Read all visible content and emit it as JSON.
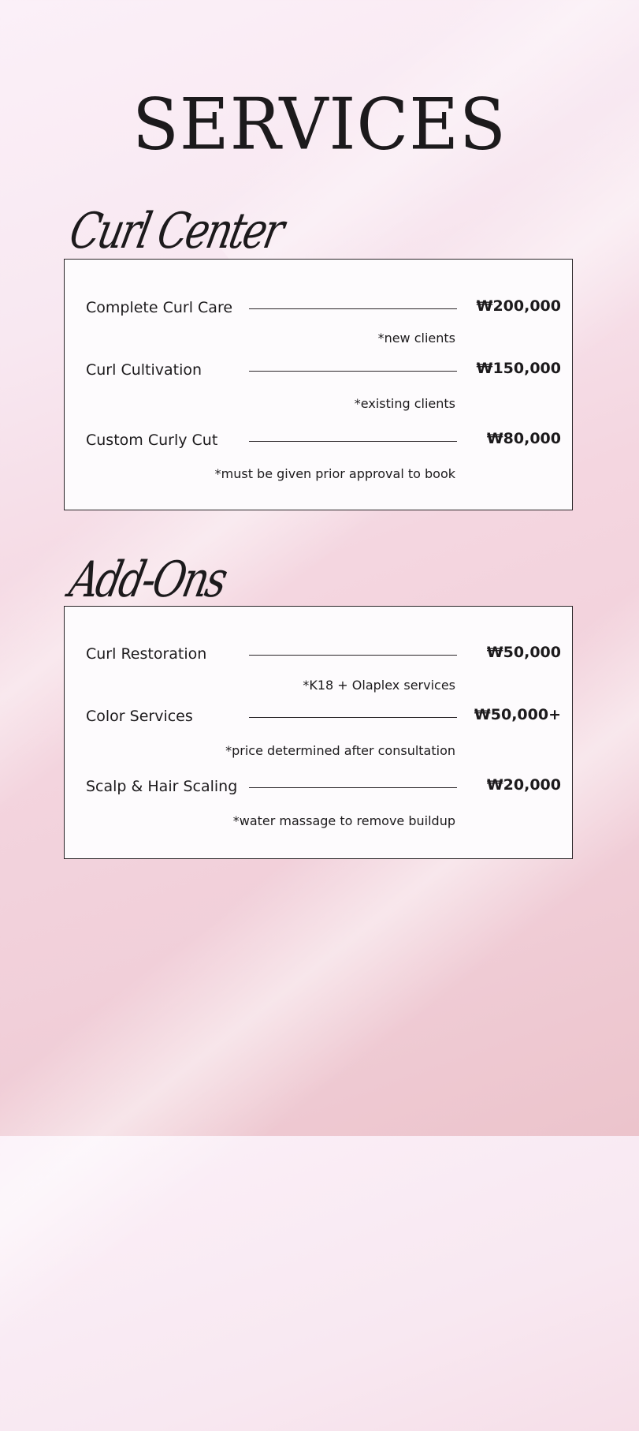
{
  "page": {
    "title": "SERVICES"
  },
  "sections": [
    {
      "heading": "Curl Center",
      "services": [
        {
          "name": "Complete Curl Care",
          "price": "₩200,000",
          "note": "*new clients"
        },
        {
          "name": "Curl Cultivation",
          "price": "₩150,000",
          "note": "*existing clients"
        },
        {
          "name": "Custom Curly Cut",
          "price": "₩80,000",
          "note": "*must be given prior approval to book"
        }
      ]
    },
    {
      "heading": "Add-Ons",
      "services": [
        {
          "name": "Curl Restoration",
          "price": "₩50,000",
          "note": "*K18 + Olaplex services"
        },
        {
          "name": "Color Services",
          "price": "₩50,000+",
          "note": "*price determined after consultation"
        },
        {
          "name": "Scalp & Hair Scaling",
          "price": "₩20,000",
          "note": "*water massage to remove buildup"
        }
      ]
    }
  ],
  "colors": {
    "background_top": "#fbf0f8",
    "background_bottom": "#ecc4cc",
    "card": "#fdfbfd",
    "ink": "#1c1a1c"
  }
}
